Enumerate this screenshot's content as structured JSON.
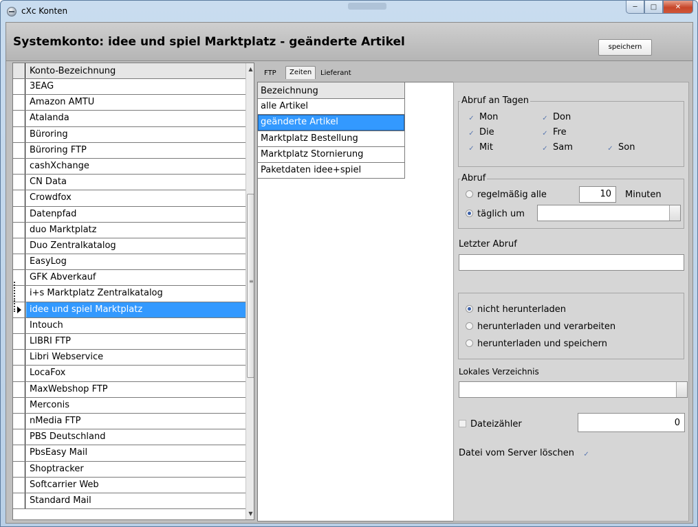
{
  "window": {
    "title": "cXc Konten"
  },
  "header": {
    "title": "Systemkonto: idee und spiel Marktplatz - geänderte Artikel",
    "save_label": "speichern"
  },
  "accounts": {
    "column_header": "Konto-Bezeichnung",
    "selected_index": 16,
    "items": [
      "3EAG",
      "Amazon AMTU",
      "Atalanda",
      "Büroring",
      "Büroring FTP",
      "cashXchange",
      "CN Data",
      "Crowdfox",
      "Datenpfad",
      "duo Marktplatz",
      "Duo Zentralkatalog",
      "EasyLog",
      "GFK Abverkauf",
      "i+s Marktplatz Zentralkatalog",
      "idee und spiel Marktplatz",
      "Intouch",
      "LIBRI FTP",
      "Libri Webservice",
      "LocaFox",
      "MaxWebshop FTP",
      "Merconis",
      "nMedia FTP",
      "PBS Deutschland",
      "PbsEasy Mail",
      "Shoptracker",
      "Softcarrier Web",
      "Standard Mail"
    ]
  },
  "tabs": {
    "ftp": "FTP",
    "zeiten": "Zeiten",
    "lieferant": "Lieferant",
    "active": "Zeiten"
  },
  "times": {
    "column_header": "Bezeichnung",
    "items": [
      "alle Artikel",
      "geänderte Artikel",
      "Marktplatz Bestellung",
      "Marktplatz Stornierung",
      "Paketdaten idee+spiel"
    ],
    "selected_index": 1
  },
  "days": {
    "legend": "Abruf an Tagen",
    "mon": "Mon",
    "die": "Die",
    "mit": "Mit",
    "don": "Don",
    "fre": "Fre",
    "sam": "Sam",
    "son": "Son",
    "checked": true
  },
  "abruf": {
    "legend": "Abruf",
    "regular_label": "regelmäßig alle",
    "interval_value": "10",
    "minutes_label": "Minuten",
    "daily_label": "täglich um",
    "daily_value": "",
    "selected": "daily"
  },
  "last_fetch": {
    "label": "Letzter Abruf",
    "value": ""
  },
  "download": {
    "options": [
      "nicht herunterladen",
      "herunterladen und verarbeiten",
      "herunterladen und speichern"
    ],
    "selected_index": 0
  },
  "local_dir": {
    "label": "Lokales Verzeichnis",
    "value": ""
  },
  "counter": {
    "label": "Dateizähler",
    "checked": false,
    "value": "0"
  },
  "delete_server": {
    "label": "Datei vom Server löschen",
    "checked": true
  },
  "colors": {
    "selection": "#3399ff",
    "panel": "#d6d6d6",
    "client": "#c0c0c0",
    "check": "#5a78b0"
  }
}
